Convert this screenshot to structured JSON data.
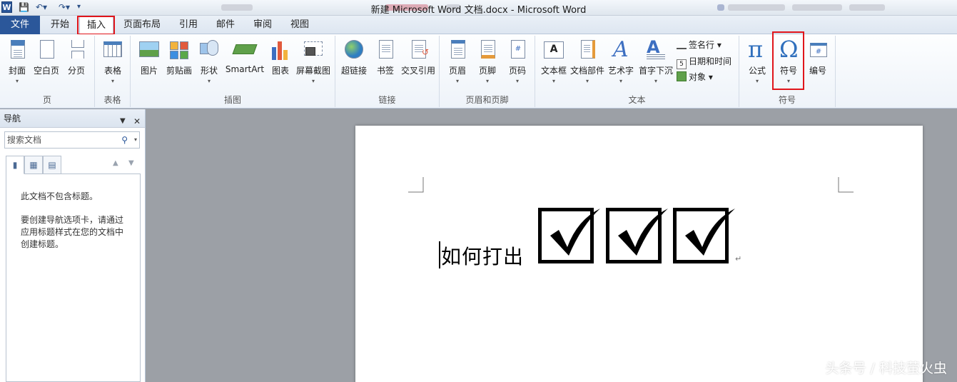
{
  "window": {
    "title": "新建 Microsoft Word 文档.docx - Microsoft Word",
    "app_icon_letter": "W"
  },
  "tabs": [
    {
      "label": "文件"
    },
    {
      "label": "开始"
    },
    {
      "label": "插入",
      "active": true
    },
    {
      "label": "页面布局"
    },
    {
      "label": "引用"
    },
    {
      "label": "邮件"
    },
    {
      "label": "审阅"
    },
    {
      "label": "视图"
    }
  ],
  "ribbon": {
    "groups": {
      "page": "页",
      "table": "表格",
      "illustrations": "插图",
      "links": "链接",
      "header_footer": "页眉和页脚",
      "text": "文本",
      "symbols": "符号"
    },
    "buttons": {
      "cover": "封面",
      "blank_page": "空白页",
      "page_break": "分页",
      "table": "表格",
      "picture": "图片",
      "clipart": "剪贴画",
      "shapes": "形状",
      "smartart": "SmartArt",
      "chart": "图表",
      "screenshot": "屏幕截图",
      "hyperlink": "超链接",
      "bookmark": "书签",
      "cross_ref": "交叉引用",
      "header": "页眉",
      "footer": "页脚",
      "page_number": "页码",
      "textbox": "文本框",
      "quick_parts": "文档部件",
      "wordart": "艺术字",
      "dropcap": "首字下沉",
      "signature_line": "签名行",
      "date_time": "日期和时间",
      "object": "对象",
      "equation": "公式",
      "symbol": "符号",
      "numbering": "编号"
    }
  },
  "nav": {
    "title": "导航",
    "search_placeholder": "搜索文档",
    "empty_line1": "此文档不包含标题。",
    "empty_line2": "要创建导航选项卡，请通过应用标题样式在您的文档中创建标题。"
  },
  "document": {
    "text": "如何打出",
    "checkbox_count": 3
  },
  "watermark": "头条号 / 科技萤火虫",
  "colors": {
    "file_tab": "#2b579a",
    "highlight": "#e0151b"
  }
}
